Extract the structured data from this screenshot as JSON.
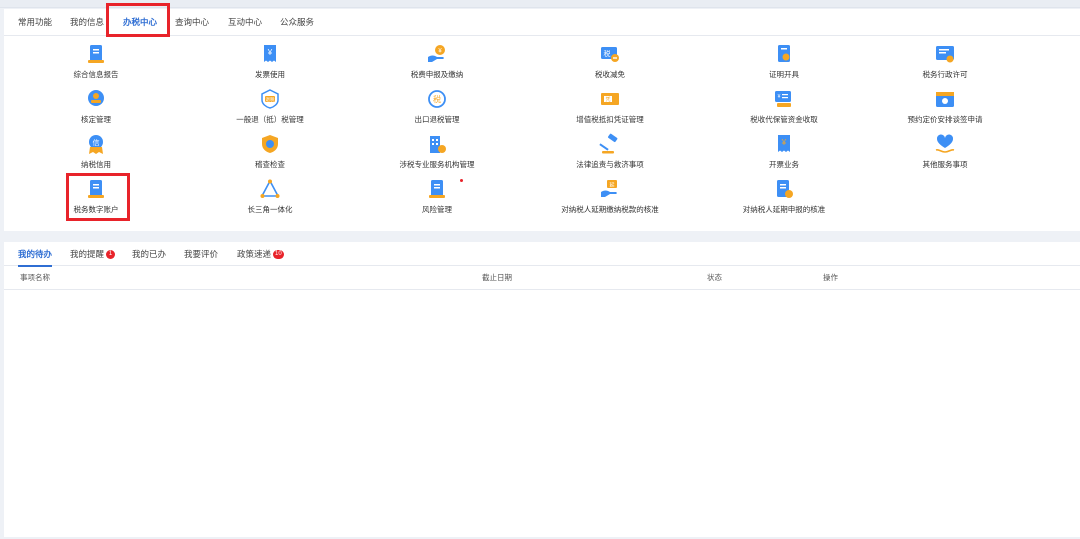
{
  "top_tabs": [
    {
      "label": "常用功能"
    },
    {
      "label": "我的信息"
    },
    {
      "label": "办税中心",
      "active": true
    },
    {
      "label": "查询中心"
    },
    {
      "label": "互动中心"
    },
    {
      "label": "公众服务"
    }
  ],
  "services": [
    {
      "label": "综合信息报告",
      "icon": "report-icon"
    },
    {
      "label": "发票使用",
      "icon": "invoice-icon"
    },
    {
      "label": "税费申报及缴纳",
      "icon": "payment-hand-icon"
    },
    {
      "label": "税收减免",
      "icon": "tax-reduction-icon"
    },
    {
      "label": "证明开具",
      "icon": "certificate-icon"
    },
    {
      "label": "税务行政许可",
      "icon": "license-icon"
    },
    {
      "label": "核定管理",
      "icon": "stamp-icon"
    },
    {
      "label": "一般退（抵）税管理",
      "icon": "refund-icon"
    },
    {
      "label": "出口退税管理",
      "icon": "export-refund-icon"
    },
    {
      "label": "增值税抵扣凭证管理",
      "icon": "voucher-icon"
    },
    {
      "label": "税收代保管资金收取",
      "icon": "custody-funds-icon"
    },
    {
      "label": "预约定价安排谈签申请",
      "icon": "calendar-icon"
    },
    {
      "label": "纳税信用",
      "icon": "credit-icon"
    },
    {
      "label": "稽查检查",
      "icon": "inspection-shield-icon"
    },
    {
      "label": "涉税专业服务机构管理",
      "icon": "building-icon"
    },
    {
      "label": "法律追责与救济事项",
      "icon": "gavel-icon"
    },
    {
      "label": "开票业务",
      "icon": "issue-invoice-icon"
    },
    {
      "label": "其他服务事项",
      "icon": "heart-hand-icon"
    },
    {
      "label": "税务数字账户",
      "icon": "digital-account-icon"
    },
    {
      "label": "长三角一体化",
      "icon": "triangle-icon"
    },
    {
      "label": "风险管理",
      "icon": "risk-document-icon"
    },
    {
      "label": "对纳税人延期缴纳税款的核准",
      "icon": "deferred-payment-icon"
    },
    {
      "label": "对纳税人延期申报的核准",
      "icon": "deferred-filing-icon"
    }
  ],
  "bottom_tabs": [
    {
      "label": "我的待办",
      "active": true
    },
    {
      "label": "我的提醒",
      "badge": "1"
    },
    {
      "label": "我的已办"
    },
    {
      "label": "我要评价"
    },
    {
      "label": "政策速递",
      "badge": "10"
    }
  ],
  "table_headers": [
    "事项名称",
    "截止日期",
    "状态",
    "操作"
  ],
  "colors": {
    "accent": "#2f6ed3",
    "icon_blue": "#3d8ff5",
    "icon_orange": "#f5a623",
    "highlight": "#e8232a"
  }
}
